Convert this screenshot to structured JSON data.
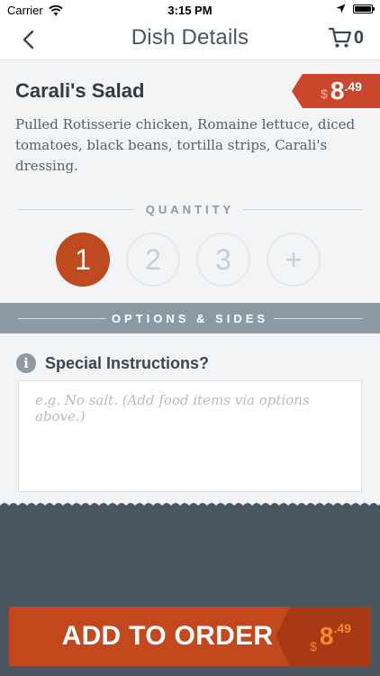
{
  "status": {
    "carrier": "Carrier",
    "time": "3:15 PM"
  },
  "nav": {
    "title": "Dish Details",
    "cart_count": "0"
  },
  "dish": {
    "name": "Carali's Salad",
    "price_currency": "$",
    "price_dollars": "8",
    "price_cents": ".49",
    "description": "Pulled Rotisserie chicken, Romaine lettuce, diced tomatoes, black beans, tortilla strips, Carali's dressing."
  },
  "quantity": {
    "label": "QUANTITY",
    "options": [
      "1",
      "2",
      "3",
      "+"
    ],
    "selected": "1"
  },
  "options_bar": {
    "label": "OPTIONS & SIDES"
  },
  "instructions": {
    "label": "Special Instructions?",
    "placeholder": "e.g. No salt. (Add food items via options above.)",
    "value": ""
  },
  "footer": {
    "add_label": "ADD TO ORDER",
    "price_currency": "$",
    "price_dollars": "8",
    "price_cents": ".49"
  },
  "colors": {
    "accent": "#c4481d",
    "accent_dark": "#a73a14",
    "price_tag": "#c9472d",
    "options_bar": "#8d99a3",
    "footer": "#4b5661",
    "price_highlight": "#f48a2b"
  },
  "icons": {
    "wifi": "wifi-icon",
    "location": "location-arrow-icon",
    "battery": "battery-icon",
    "back": "chevron-left-icon",
    "cart": "cart-icon",
    "info": "info-icon"
  }
}
